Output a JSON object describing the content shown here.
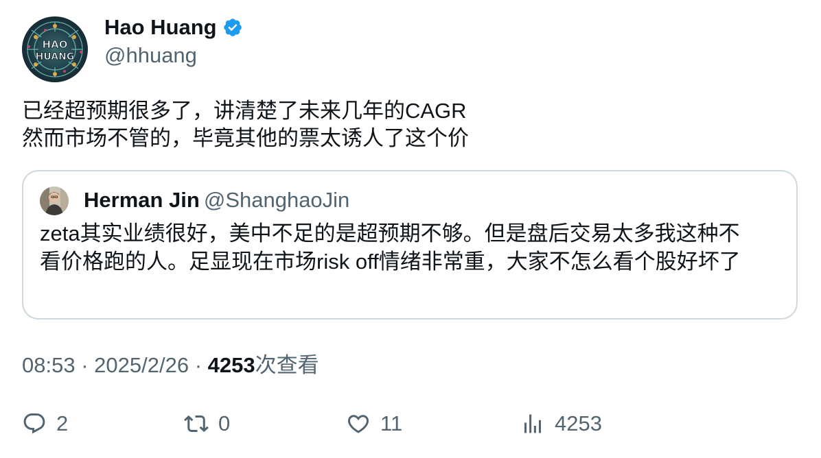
{
  "author": {
    "display_name": "Hao Huang",
    "handle": "@hhuang",
    "verified": true,
    "avatar_text_line1": "HAO",
    "avatar_text_line2": "HUANG"
  },
  "tweet": {
    "lines": [
      "已经超预期很多了，讲清楚了未来几年的CAGR",
      "然而市场不管的，毕竟其他的票太诱人了这个价"
    ]
  },
  "quote": {
    "display_name": "Herman Jin",
    "handle": "@ShanghaoJin",
    "lines": [
      "zeta其实业绩很好，美中不足的是超预期不够。但是盘后交易太多我这种不",
      "看价格跑的人。足显现在市场risk off情绪非常重，大家不怎么看个股好坏了"
    ]
  },
  "meta": {
    "time": "08:53",
    "separator": "·",
    "date": "2025/2/26",
    "views_count": "4253",
    "views_label": "次查看"
  },
  "actions": {
    "replies": "2",
    "retweets": "0",
    "likes": "11",
    "views": "4253"
  },
  "colors": {
    "text": "#0f1419",
    "secondary": "#536471",
    "verified": "#1d9bf0",
    "border": "#cfd9de"
  },
  "icons": [
    "verified-badge-icon",
    "reply-icon",
    "retweet-icon",
    "like-icon",
    "views-icon"
  ]
}
